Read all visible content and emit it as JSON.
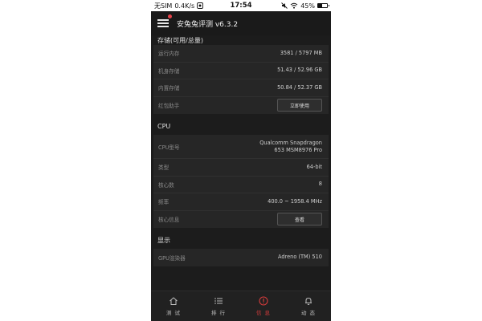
{
  "status_bar": {
    "carrier": "无SIM",
    "speed": "0.4K/s",
    "time": "17:54",
    "battery": "45%",
    "battery_level": 0.45
  },
  "app_bar": {
    "title": "安兔兔评测 v6.3.2"
  },
  "sections": {
    "storage": {
      "title": "存储(可用/总量)",
      "rows": [
        {
          "label": "运行内存",
          "value": "3581 / 5797 MB"
        },
        {
          "label": "机身存储",
          "value": "51.43 / 52.96 GB"
        },
        {
          "label": "内置存储",
          "value": "50.84 / 52.37 GB"
        },
        {
          "label": "红包助手",
          "button": "立即使用"
        }
      ]
    },
    "cpu": {
      "title": "CPU",
      "rows": [
        {
          "label": "CPU型号",
          "value_line1": "Qualcomm Snapdragon",
          "value_line2": "653 MSM8976 Pro"
        },
        {
          "label": "类型",
          "value": "64-bit"
        },
        {
          "label": "核心数",
          "value": "8"
        },
        {
          "label": "频率",
          "value": "400.0 ~ 1958.4 MHz"
        },
        {
          "label": "核心信息",
          "button": "查看"
        }
      ]
    },
    "display": {
      "title": "显示",
      "rows": [
        {
          "label": "GPU渲染器",
          "value": "Adreno (TM) 510"
        }
      ]
    }
  },
  "bottom_nav": [
    {
      "label": "测 试",
      "icon": "home-icon",
      "active": false
    },
    {
      "label": "排 行",
      "icon": "list-icon",
      "active": false
    },
    {
      "label": "信 息",
      "icon": "info-icon",
      "active": true
    },
    {
      "label": "动 态",
      "icon": "bell-icon",
      "active": false
    }
  ],
  "colors": {
    "accent": "#d23b3b",
    "background": "#1c1c1c",
    "card": "#262626"
  }
}
